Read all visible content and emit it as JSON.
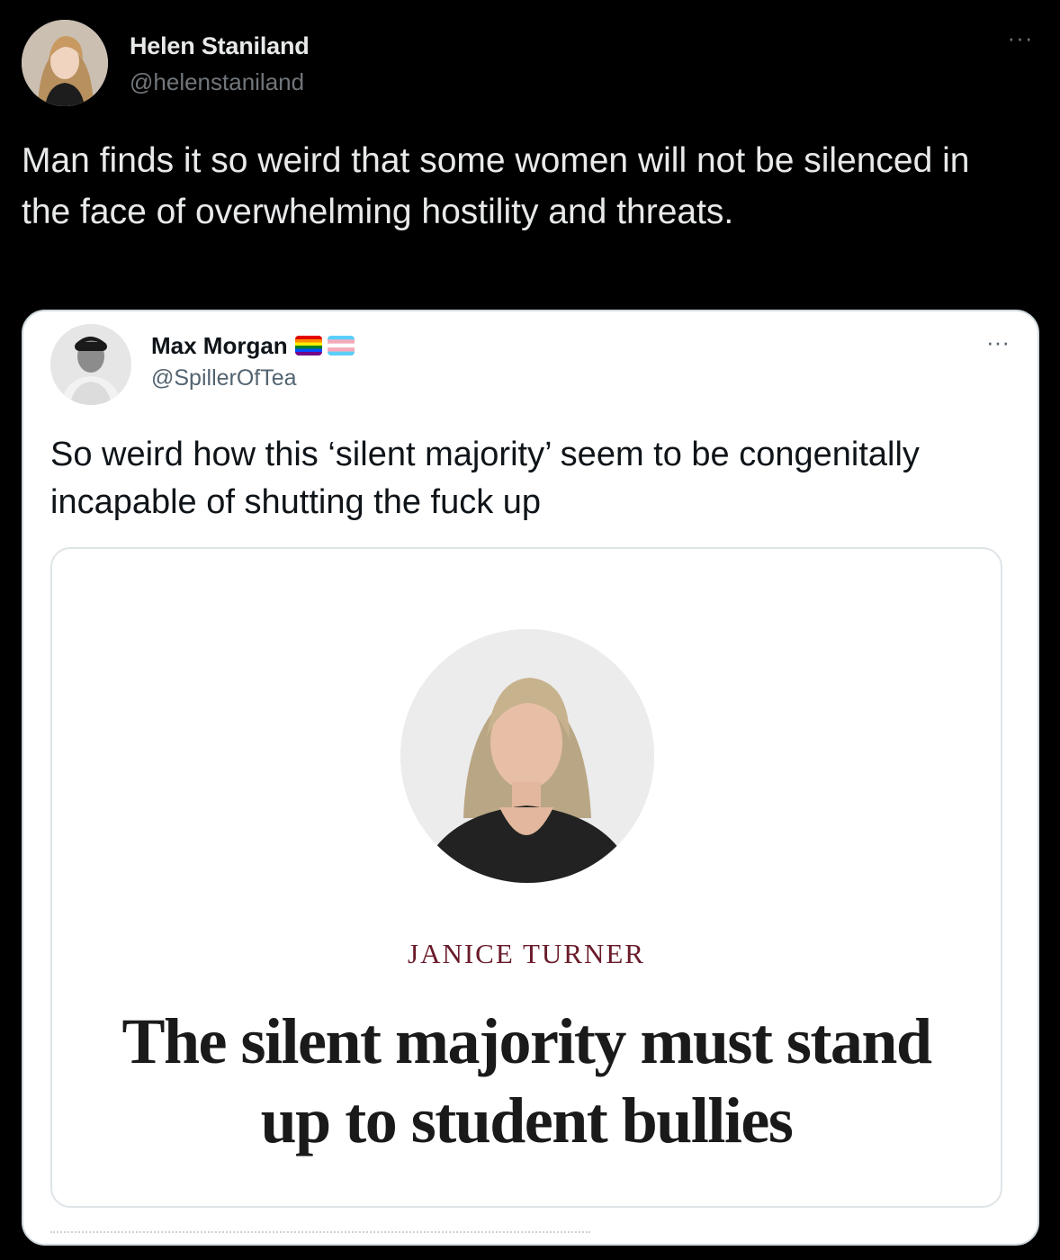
{
  "outer_tweet": {
    "author_name": "Helen Staniland",
    "author_handle": "@helenstaniland",
    "more_label": "···",
    "text": "Man finds it so weird that some women will not be silenced in the face of overwhelming hostility and threats."
  },
  "quoted_tweet": {
    "author_name": "Max Morgan",
    "author_handle": "@SpillerOfTea",
    "flags": [
      "rainbow-pride-flag-icon",
      "transgender-flag-icon"
    ],
    "more_label": "···",
    "text": "So weird how this ‘silent majority’ seem to be congenitally incapable of shutting the fuck up",
    "media": {
      "author": "JANICE TURNER",
      "headline": "The silent majority must stand up to student bullies"
    }
  },
  "colors": {
    "background": "#000000",
    "primary_text_dark": "#e7e9ea",
    "secondary_text_dark": "#71767b",
    "card_border": "#cfd9de",
    "author_accent": "#6a1b2a"
  }
}
